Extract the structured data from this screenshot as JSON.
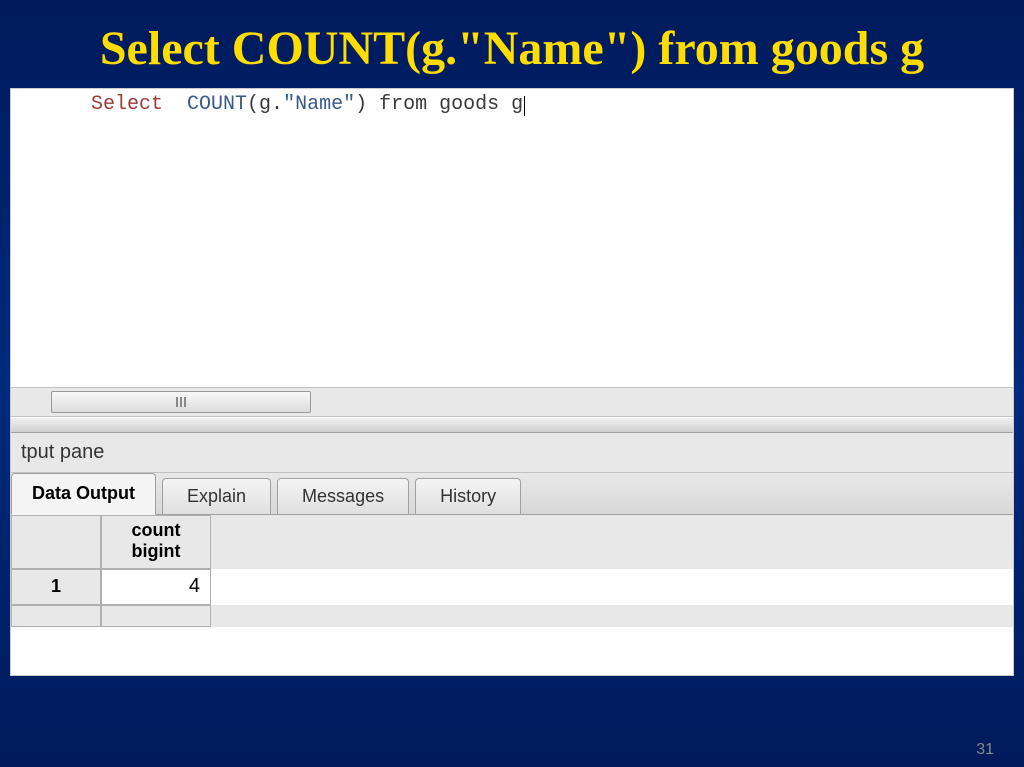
{
  "slide": {
    "title": "Select  COUNT(g.\"Name\") from goods g",
    "page_number": "31"
  },
  "sql": {
    "select": "Select ",
    "count_open": " COUNT",
    "paren_open": "(",
    "g_dot": "g.",
    "name_str": "\"Name\"",
    "paren_close": ")",
    "from_part": " from goods g"
  },
  "output_pane": {
    "label": "tput pane"
  },
  "tabs": {
    "data_output": "Data Output",
    "explain": "Explain",
    "messages": "Messages",
    "history": "History"
  },
  "grid": {
    "col_header_line1": "count",
    "col_header_line2": "bigint",
    "row1_num": "1",
    "row1_val": "4"
  }
}
